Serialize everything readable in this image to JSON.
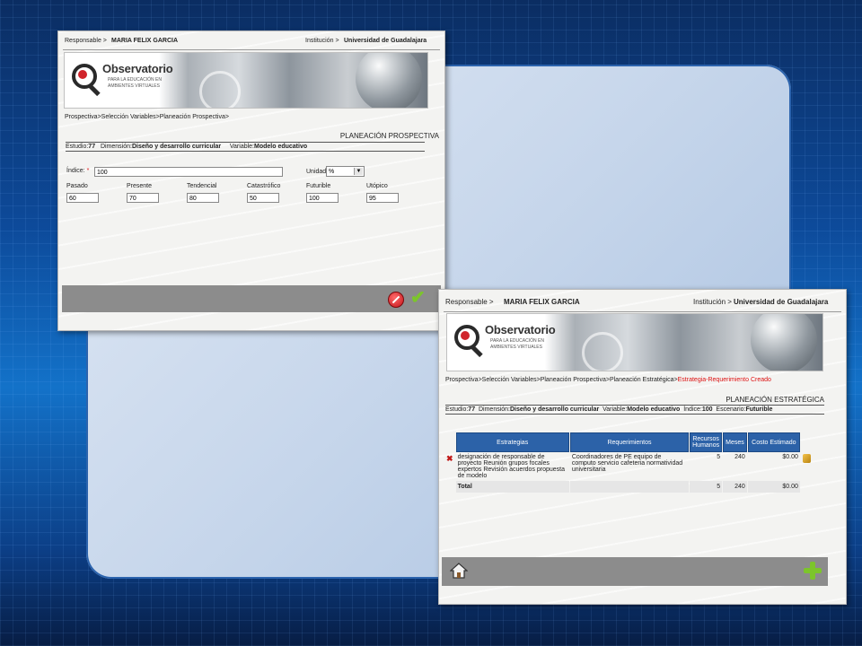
{
  "colors": {
    "accent": "#2c62a8",
    "error": "#d11111",
    "ok": "#7cc52b"
  },
  "win1": {
    "responsable_label": "Responsable  >",
    "responsable_value": "MARIA FELIX GARCIA",
    "institucion_label": "Institución  >",
    "institucion_value": "Universidad de Guadalajara",
    "logo_title": "Observatorio",
    "logo_sub": "PARA LA EDUCACIÓN EN AMBIENTES VIRTUALES",
    "breadcrumb": "Prospectiva>Selección Variables>Planeación Prospectiva>",
    "section_title": "PLANEACIÓN PROSPECTIVA",
    "info": {
      "estudio_label": "Estudio:",
      "estudio": "77",
      "dimension_label": "Dimensión:",
      "dimension": "Diseño y desarrollo curricular",
      "variable_label": "Variable:",
      "variable": "Modelo educativo"
    },
    "indice_label": "Índice:",
    "indice_required": "*",
    "indice_value": "100",
    "unidad_label": "Unidad:",
    "unidad_value": "%",
    "fields": [
      {
        "label": "Pasado",
        "value": "60"
      },
      {
        "label": "Presente",
        "value": "70"
      },
      {
        "label": "Tendencial",
        "value": "80"
      },
      {
        "label": "Catastrófico",
        "value": "50"
      },
      {
        "label": "Futurible",
        "value": "100"
      },
      {
        "label": "Utópico",
        "value": "95"
      }
    ],
    "icons": {
      "cancel": "cancel-icon",
      "ok": "checkmark-icon"
    }
  },
  "win2": {
    "responsable_label": "Responsable  >",
    "responsable_value": "MARIA FELIX GARCIA",
    "institucion_label": "Institución  >",
    "institucion_value": "Universidad de Guadalajara",
    "logo_title": "Observatorio",
    "logo_sub": "PARA LA EDUCACIÓN EN AMBIENTES VIRTUALES",
    "breadcrumb": "Prospectiva>Selección Variables>Planeación Prospectiva>Planeación Estratégica>",
    "breadcrumb_current": "Estrategia-Requerimiento Creado",
    "section_title": "PLANEACIÓN ESTRATÉGICA",
    "info": {
      "estudio_label": "Estudio:",
      "estudio": "77",
      "dimension_label": "Dimensión:",
      "dimension": "Diseño y desarrollo curricular",
      "variable_label": "Variable:",
      "variable": "Modelo educativo",
      "indice_label": "Índice:",
      "indice": "100",
      "escenario_label": "Escenario:",
      "escenario": "Futurible"
    },
    "table": {
      "headers": [
        "Estrategias",
        "Requerimientos",
        "Recursos Humanos",
        "Meses",
        "Costo Estimado"
      ],
      "rows": [
        {
          "estrategia": "designación de responsable de proyecto Reunión grupos focales expertos Revisión acuerdos propuesta de modelo",
          "requerimiento": "Coordinadores de PE equipo de computo servicio cafeteria normatividad universitaria",
          "recursos": "5",
          "meses": "240",
          "costo": "$0.00"
        }
      ],
      "total": {
        "label": "Total",
        "recursos": "5",
        "meses": "240",
        "costo": "$0.00"
      }
    },
    "icons": {
      "delete": "delete-icon",
      "edit": "edit-icon",
      "home": "home-icon",
      "add": "add-icon"
    }
  }
}
